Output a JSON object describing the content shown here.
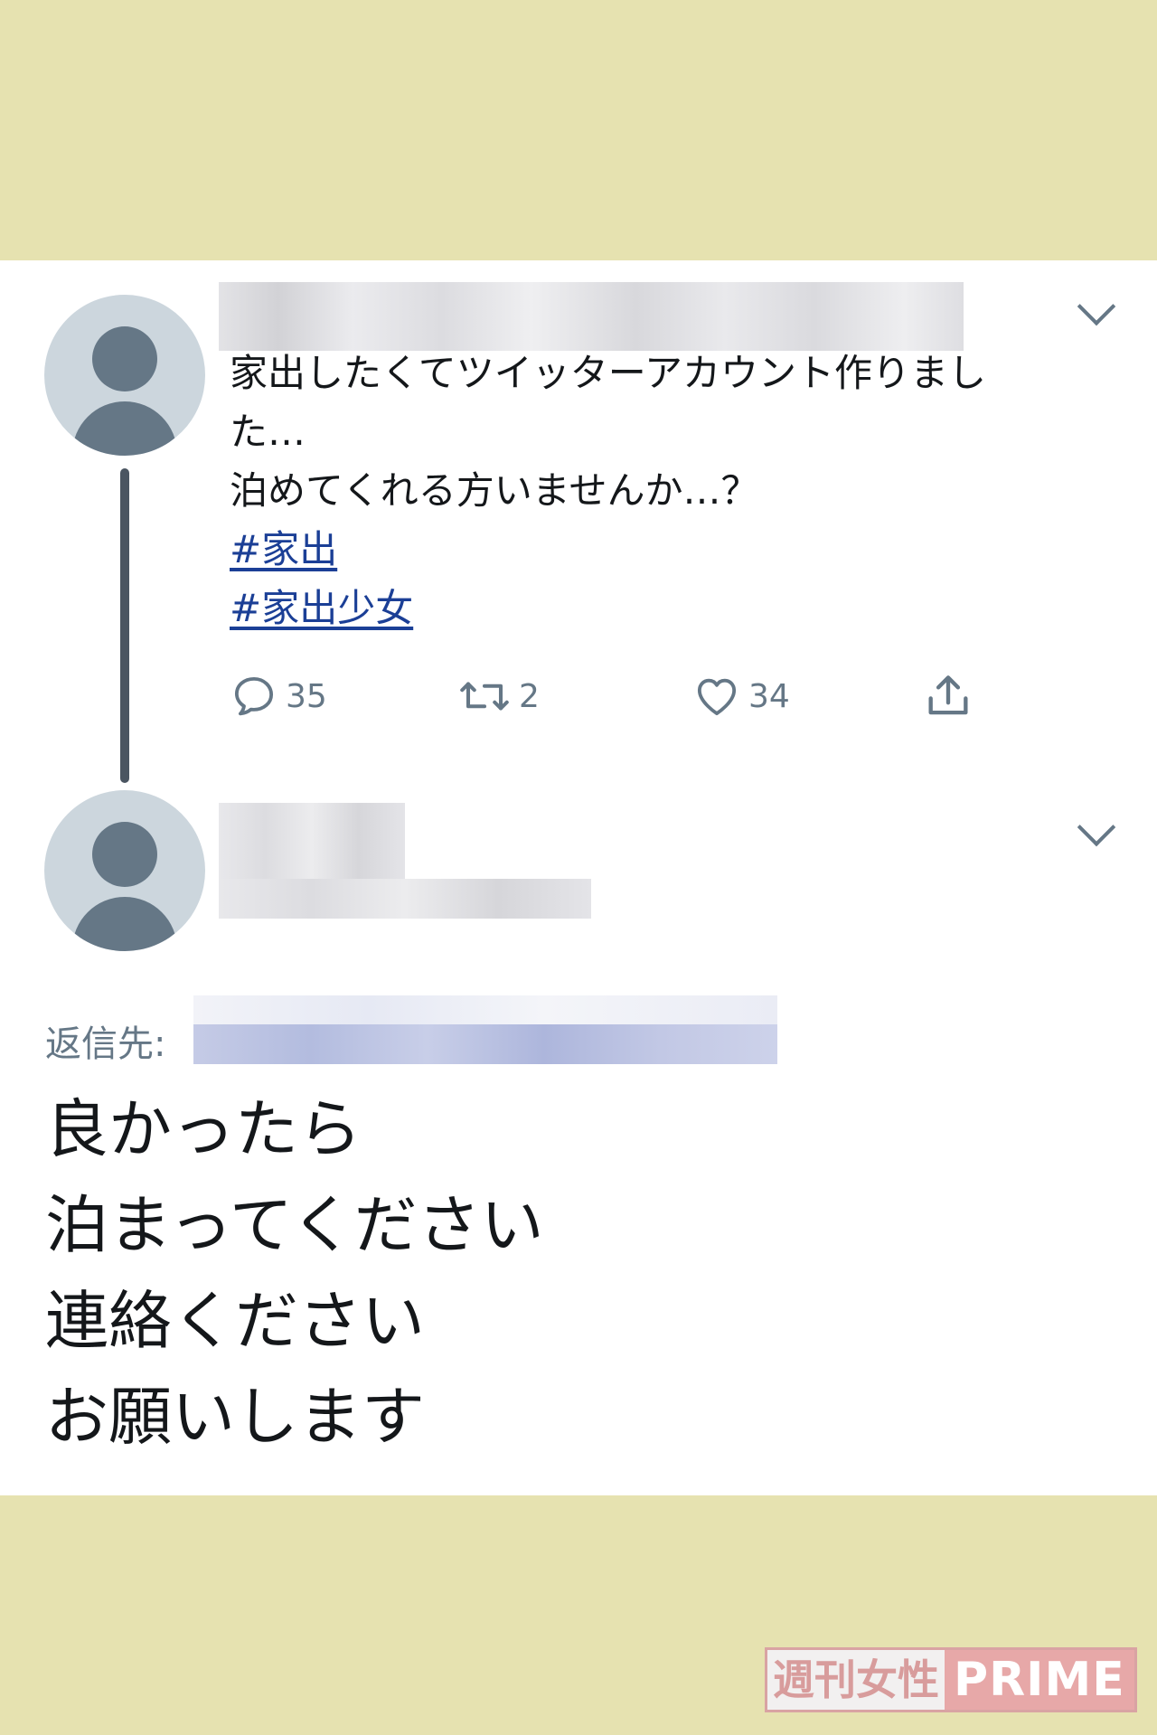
{
  "tweet": {
    "lines": [
      "家出したくてツイッターアカウント作りまし",
      "た…",
      "泊めてくれる方いませんか…？"
    ],
    "hashtags": [
      "#家出",
      "#家出少女"
    ],
    "actions": {
      "reply_icon": "speech-bubble-icon",
      "reply_count": "35",
      "retweet_icon": "retweet-icon",
      "retweet_count": "2",
      "like_icon": "heart-icon",
      "like_count": "34",
      "share_icon": "share-upload-icon"
    }
  },
  "reply": {
    "reply_to_label": "返信先:",
    "lines": [
      "良かったら",
      "泊まってください",
      "連絡ください",
      "お願いします"
    ]
  },
  "watermark": {
    "jp": "週刊女性",
    "en": "PRIME"
  },
  "colors": {
    "background": "#e6e2b0",
    "card": "#ffffff",
    "text": "#14171a",
    "muted": "#657786",
    "hashtag": "#1b3f96",
    "avatar_bg": "#ccd6dd",
    "avatar_fg": "#657786"
  }
}
